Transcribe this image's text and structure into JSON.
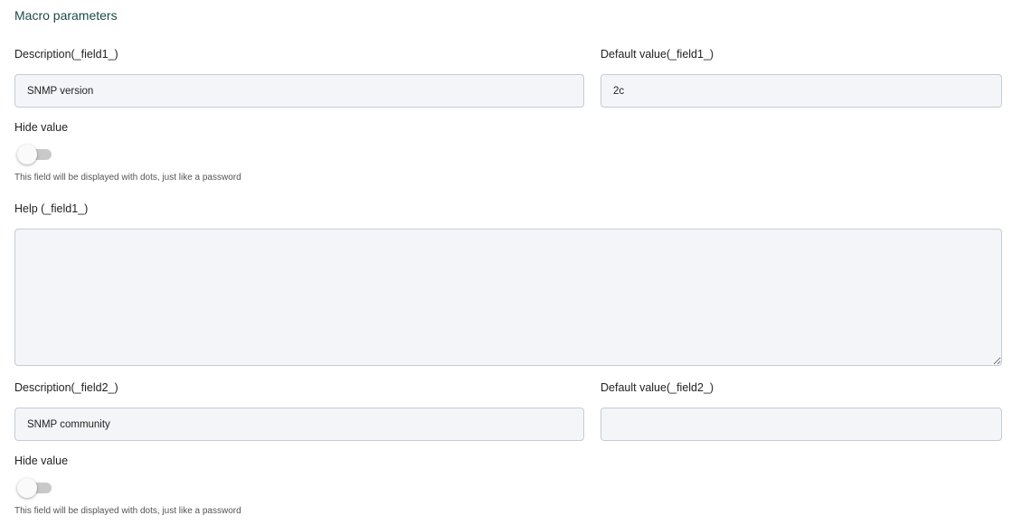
{
  "section": {
    "title": "Macro parameters"
  },
  "field1": {
    "description_label": "Description(_field1_)",
    "description_value": "SNMP version",
    "default_label": "Default value(_field1_)",
    "default_value": "2c",
    "hide_label": "Hide value",
    "hide_enabled": false,
    "hide_hint": "This field will be displayed with dots, just like a password",
    "help_label": "Help (_field1_)",
    "help_value": ""
  },
  "field2": {
    "description_label": "Description(_field2_)",
    "description_value": "SNMP community",
    "default_label": "Default value(_field2_)",
    "default_value": "",
    "hide_label": "Hide value",
    "hide_enabled": false,
    "hide_hint": "This field will be displayed with dots, just like a password"
  }
}
